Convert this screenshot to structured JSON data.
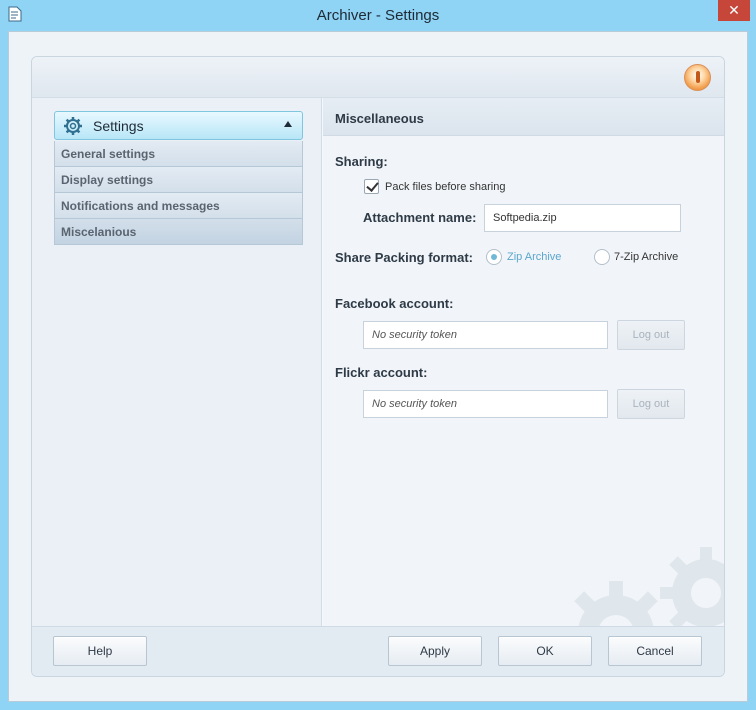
{
  "window": {
    "title": "Archiver - Settings",
    "close_glyph": "✕",
    "app_icon": "document-icon"
  },
  "sidebar": {
    "header_label": "Settings",
    "items": [
      {
        "label": "General settings"
      },
      {
        "label": "Display settings"
      },
      {
        "label": "Notifications and messages"
      },
      {
        "label": "Miscelanious"
      }
    ]
  },
  "content": {
    "title": "Miscellaneous",
    "sharing": {
      "label": "Sharing:",
      "pack_label": "Pack files before sharing",
      "pack_checked": true,
      "attachment_label": "Attachment name:",
      "attachment_value": "Softpedia.zip"
    },
    "format": {
      "label": "Share Packing format:",
      "options": [
        {
          "label": "Zip Archive",
          "selected": true
        },
        {
          "label": "7-Zip Archive",
          "selected": false
        }
      ]
    },
    "facebook": {
      "label": "Facebook account:",
      "token": "No security token",
      "logout": "Log out"
    },
    "flickr": {
      "label": "Flickr account:",
      "token": "No security token",
      "logout": "Log out"
    }
  },
  "footer": {
    "help": "Help",
    "apply": "Apply",
    "ok": "OK",
    "cancel": "Cancel"
  },
  "colors": {
    "titlebar": "#8fd3f5",
    "accent": "#6fb8d8",
    "close": "#c7463a"
  }
}
